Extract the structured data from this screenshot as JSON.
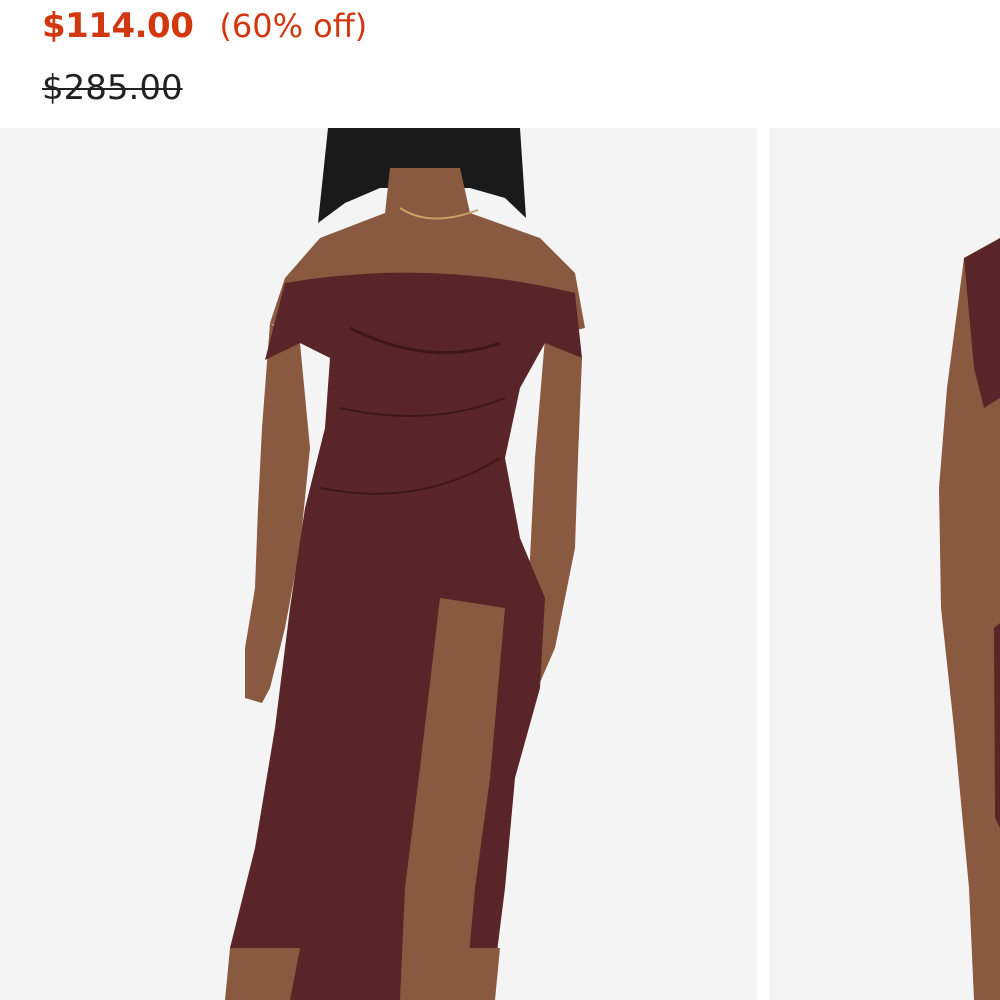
{
  "product": {
    "sale_price": "$114.00",
    "discount": "(60% off)",
    "original_price": "$285.00"
  },
  "colors": {
    "sale": "#d2380f",
    "dress": "#5a2528",
    "skin": "#8a5a40",
    "hair": "#1a1a1a",
    "image_background": "#f4f4f5"
  },
  "gallery": {
    "images": [
      {
        "subject": "model-off-shoulder-dress-front"
      },
      {
        "subject": "model-dress-partial-view"
      }
    ]
  }
}
